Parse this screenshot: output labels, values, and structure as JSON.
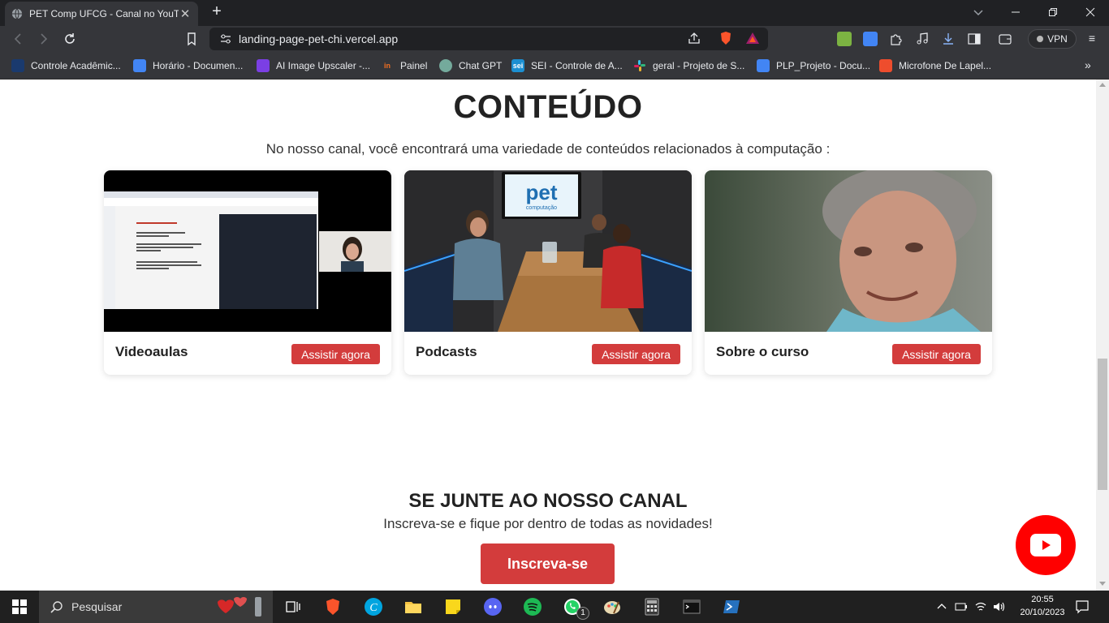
{
  "browser": {
    "tab_title": "PET Comp UFCG - Canal no YouTube",
    "url": "landing-page-pet-chi.vercel.app",
    "vpn_label": "VPN"
  },
  "bookmarks": [
    {
      "label": "Controle Acadêmic...",
      "color": "#1a3a6e"
    },
    {
      "label": "Horário - Documen...",
      "color": "#4285f4"
    },
    {
      "label": "AI Image Upscaler -...",
      "color": "#7b3fe4"
    },
    {
      "label": "Painel",
      "color": "#f37021"
    },
    {
      "label": "Chat GPT",
      "color": "#74aa9c"
    },
    {
      "label": "SEI - Controle de A...",
      "color": "#1c8fd1"
    },
    {
      "label": "geral - Projeto de S...",
      "color": "#e01e5a"
    },
    {
      "label": "PLP_Projeto - Docu...",
      "color": "#4285f4"
    },
    {
      "label": "Microfone De Lapel...",
      "color": "#ee4d2d"
    }
  ],
  "page": {
    "section_title": "CONTEÚDO",
    "section_subtitle": "No nosso canal, você encontrará uma variedade de conteúdos relacionados à computação :",
    "cards": [
      {
        "label": "Videoaulas",
        "button": "Assistir agora"
      },
      {
        "label": "Podcasts",
        "button": "Assistir agora"
      },
      {
        "label": "Sobre o curso",
        "button": "Assistir agora"
      }
    ],
    "podcast_logo": "pet",
    "podcast_logo_sub": "computação",
    "join_title": "SE JUNTE AO NOSSO CANAL",
    "join_subtitle": "Inscreva-se e fique por dentro de todas as novidades!",
    "subscribe_button": "Inscreva-se"
  },
  "taskbar": {
    "search_placeholder": "Pesquisar",
    "time": "20:55",
    "date": "20/10/2023",
    "whatsapp_badge": "1"
  },
  "colors": {
    "accent_red": "#d33c3c",
    "youtube_red": "#ff0000"
  }
}
